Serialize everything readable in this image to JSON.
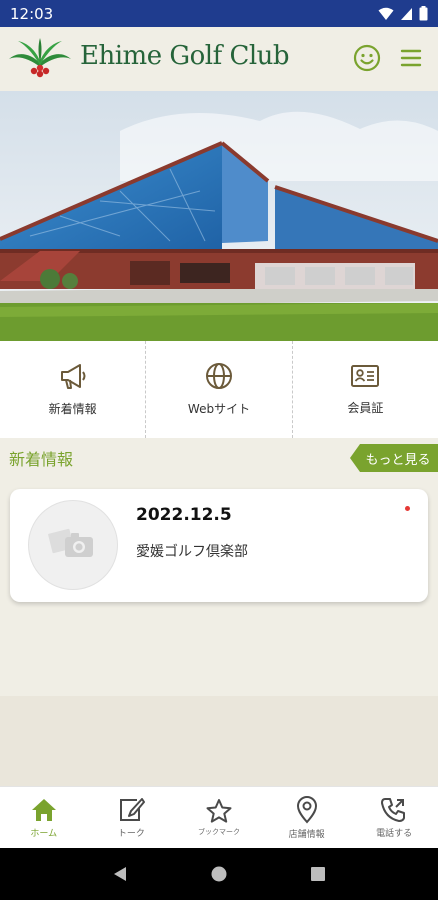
{
  "status": {
    "time": "12:03"
  },
  "header": {
    "brand": "Ehime Golf Club"
  },
  "quick": [
    {
      "label": "新着情報",
      "icon": "megaphone-icon"
    },
    {
      "label": "Webサイト",
      "icon": "globe-icon"
    },
    {
      "label": "会員証",
      "icon": "id-card-icon"
    }
  ],
  "news": {
    "title": "新着情報",
    "more": "もっと見る",
    "items": [
      {
        "date": "2022.12.5",
        "text": "愛媛ゴルフ倶楽部"
      }
    ]
  },
  "tabs": [
    {
      "label": "ホーム",
      "icon": "home-icon"
    },
    {
      "label": "トーク",
      "icon": "edit-icon"
    },
    {
      "label": "ブックマーク",
      "icon": "star-icon"
    },
    {
      "label": "店舗情報",
      "icon": "map-pin-icon"
    },
    {
      "label": "電話する",
      "icon": "phone-icon"
    }
  ],
  "colors": {
    "accent": "#7aa32e",
    "brand": "#26643a",
    "statusbar": "#1f3c8e"
  }
}
